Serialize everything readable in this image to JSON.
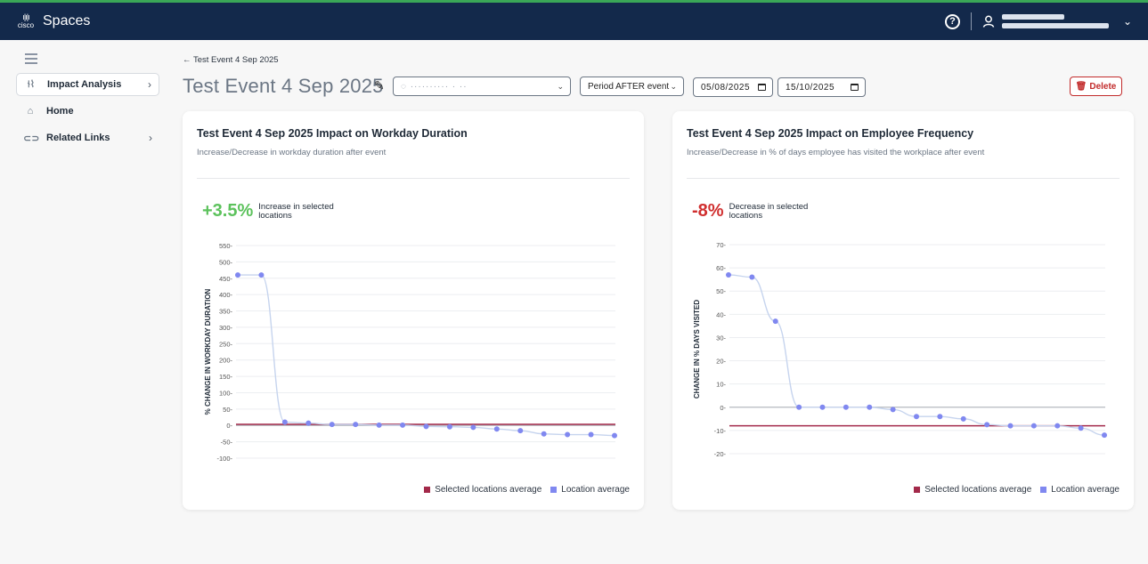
{
  "topbar": {
    "app_title": "Spaces",
    "logo_text": "cisco",
    "help_glyph": "?"
  },
  "sidebar": {
    "items": [
      {
        "label": "Impact Analysis",
        "icon": "impact-icon",
        "active": true
      },
      {
        "label": "Home",
        "icon": "home-icon",
        "active": false
      },
      {
        "label": "Related Links",
        "icon": "link-icon",
        "active": false
      }
    ]
  },
  "header": {
    "breadcrumb": "← Test Event 4 Sep 2025",
    "title": "Test Event 4 Sep 2025",
    "location_select": "◌ ·········· · ··",
    "period_select": "Period AFTER event",
    "start_date": "05/08/2025",
    "end_date": "15/10/2025",
    "delete_label": "Delete"
  },
  "colors": {
    "topbar_bg": "#13294b",
    "increase": "#5cc25c",
    "decrease": "#d02f2f",
    "selected_avg": "#a3294a",
    "location_avg": "#8088f0",
    "delete": "#c22b2b"
  },
  "cards": [
    {
      "title": "Test Event 4 Sep 2025 Impact on Workday Duration",
      "subtitle": "Increase/Decrease in workday duration after event",
      "kpi_value": "+3.5%",
      "kpi_label": "Increase in selected locations",
      "legend_selected": "Selected locations average",
      "legend_location": "Location average"
    },
    {
      "title": "Test Event 4 Sep 2025 Impact on Employee Frequency",
      "subtitle": "Increase/Decrease in % of days employee has visited the workplace after event",
      "kpi_value": "-8%",
      "kpi_label": "Decrease in selected locations",
      "legend_selected": "Selected locations average",
      "legend_location": "Location average"
    }
  ],
  "chart_data": [
    {
      "type": "line",
      "title": "",
      "xlabel": "",
      "ylabel": "% CHANGE IN WORKDAY DURATION",
      "ylim": [
        -100,
        550
      ],
      "yticks": [
        550,
        500,
        450,
        400,
        350,
        300,
        250,
        200,
        150,
        100,
        50,
        0,
        -50,
        -100
      ],
      "grid": true,
      "legend": "bottom-right",
      "series": [
        {
          "name": "Location average",
          "values": [
            460,
            460,
            10,
            7,
            3,
            3,
            1,
            1,
            -3,
            -4,
            -6,
            -11,
            -16,
            -26,
            -28,
            -28,
            -31
          ]
        },
        {
          "name": "Selected locations average",
          "values": [
            3.5,
            3.5,
            3.5,
            3.5,
            3.5,
            3.5,
            3.5,
            3.5,
            3.5,
            3.5,
            3.5,
            3.5,
            3.5,
            3.5,
            3.5,
            3.5,
            3.5
          ]
        }
      ]
    },
    {
      "type": "line",
      "title": "",
      "xlabel": "",
      "ylabel": "CHANGE IN % DAYS VISITED",
      "ylim": [
        -20,
        70
      ],
      "yticks": [
        70,
        60,
        50,
        40,
        30,
        20,
        10,
        0,
        -10,
        -20
      ],
      "grid": true,
      "legend": "bottom-right",
      "series": [
        {
          "name": "Location average",
          "values": [
            57,
            56,
            37,
            0,
            0,
            0,
            0,
            -1,
            -4,
            -4,
            -5,
            -7.5,
            -8,
            -8,
            -8,
            -9,
            -12
          ]
        },
        {
          "name": "Selected locations average",
          "values": [
            -8,
            -8,
            -8,
            -8,
            -8,
            -8,
            -8,
            -8,
            -8,
            -8,
            -8,
            -8,
            -8,
            -8,
            -8,
            -8,
            -8
          ]
        }
      ]
    }
  ]
}
